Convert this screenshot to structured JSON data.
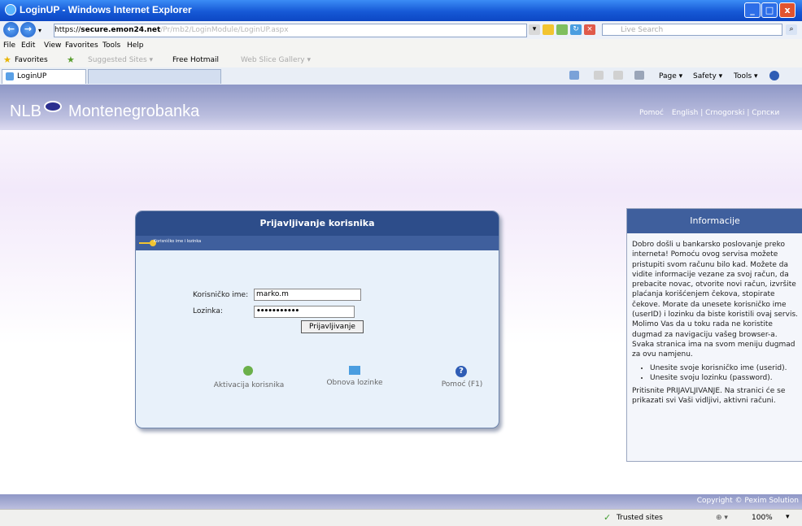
{
  "window": {
    "title": "LoginUP - Windows Internet Explorer",
    "minimize_label": "_",
    "maximize_label": "□",
    "close_label": "x"
  },
  "browser": {
    "address_scheme": "https://",
    "address_host": "secure.emon24.net",
    "address_path": "/Pr/mb2/LoginModule/LoginUP.aspx",
    "search_placeholder": "Live Search",
    "back_label": "←",
    "forward_label": "→",
    "menu": [
      "File",
      "Edit",
      "View",
      "Favorites",
      "Tools",
      "Help"
    ],
    "favorites_label": "Favorites",
    "fav_links": [
      "Suggested Sites ▾",
      "Free Hotmail",
      "Web Slice Gallery ▾"
    ],
    "tab_title": "LoginUP",
    "commands": [
      "Page ▾",
      "Safety ▾",
      "Tools ▾"
    ],
    "status_zone": "Trusted sites",
    "zoom": "100%"
  },
  "page": {
    "logo_text_left": "NLB",
    "logo_text_right": "Montenegrobanka",
    "help_link": "Pomoć",
    "languages": "English | Crnogorski | Српски",
    "copyright": "Copyright © Pexim Solution"
  },
  "login": {
    "title": "Prijavljivanje korisnika",
    "subtitle": "Korisničko ime i lozinka",
    "username_label": "Korisničko ime:",
    "username_value": "marko.m",
    "password_label": "Lozinka:",
    "password_value": "•••••••••••",
    "submit_label": "Prijavljivanje",
    "activation_link": "Aktivacija korisnika",
    "reset_link": "Obnova lozinke",
    "help_link": "Pomoć (F1)"
  },
  "info": {
    "title": "Informacije",
    "intro": "Dobro došli u bankarsko poslovanje preko interneta! Pomoću ovog servisa možete pristupiti svom računu bilo kad. Možete da vidite informacije vezane za svoj račun, da prebacite novac, otvorite novi račun, izvršite plaćanja korišćenjem čekova, stopirate čekove. Morate da unesete korisničko ime (userID) i lozinku da biste koristili ovaj servis. Molimo Vas da u toku rada ne koristite dugmad za navigaciju vašeg browser-a. Svaka stranica ima na svom meniju dugmad za ovu namjenu.",
    "bullets": [
      "Unesite svoje korisničko ime (userid).",
      "Unesite svoju lozinku (password)."
    ],
    "outro": "Pritisnite PRIJAVLJIVANJE. Na stranici će se prikazati svi Vaši vidljivi, aktivni računi."
  },
  "colors": {
    "header_bg": "#8e97c6",
    "box_header": "#2d4d8a",
    "box_bg": "#e8f1fa"
  }
}
